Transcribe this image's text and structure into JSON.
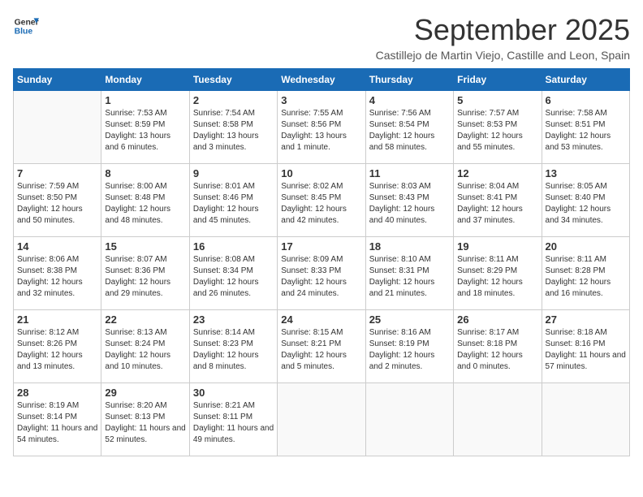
{
  "logo": {
    "line1": "General",
    "line2": "Blue"
  },
  "title": "September 2025",
  "subtitle": "Castillejo de Martin Viejo, Castille and Leon, Spain",
  "weekdays": [
    "Sunday",
    "Monday",
    "Tuesday",
    "Wednesday",
    "Thursday",
    "Friday",
    "Saturday"
  ],
  "weeks": [
    [
      {
        "day": "",
        "info": ""
      },
      {
        "day": "1",
        "info": "Sunrise: 7:53 AM\nSunset: 8:59 PM\nDaylight: 13 hours\nand 6 minutes."
      },
      {
        "day": "2",
        "info": "Sunrise: 7:54 AM\nSunset: 8:58 PM\nDaylight: 13 hours\nand 3 minutes."
      },
      {
        "day": "3",
        "info": "Sunrise: 7:55 AM\nSunset: 8:56 PM\nDaylight: 13 hours\nand 1 minute."
      },
      {
        "day": "4",
        "info": "Sunrise: 7:56 AM\nSunset: 8:54 PM\nDaylight: 12 hours\nand 58 minutes."
      },
      {
        "day": "5",
        "info": "Sunrise: 7:57 AM\nSunset: 8:53 PM\nDaylight: 12 hours\nand 55 minutes."
      },
      {
        "day": "6",
        "info": "Sunrise: 7:58 AM\nSunset: 8:51 PM\nDaylight: 12 hours\nand 53 minutes."
      }
    ],
    [
      {
        "day": "7",
        "info": "Sunrise: 7:59 AM\nSunset: 8:50 PM\nDaylight: 12 hours\nand 50 minutes."
      },
      {
        "day": "8",
        "info": "Sunrise: 8:00 AM\nSunset: 8:48 PM\nDaylight: 12 hours\nand 48 minutes."
      },
      {
        "day": "9",
        "info": "Sunrise: 8:01 AM\nSunset: 8:46 PM\nDaylight: 12 hours\nand 45 minutes."
      },
      {
        "day": "10",
        "info": "Sunrise: 8:02 AM\nSunset: 8:45 PM\nDaylight: 12 hours\nand 42 minutes."
      },
      {
        "day": "11",
        "info": "Sunrise: 8:03 AM\nSunset: 8:43 PM\nDaylight: 12 hours\nand 40 minutes."
      },
      {
        "day": "12",
        "info": "Sunrise: 8:04 AM\nSunset: 8:41 PM\nDaylight: 12 hours\nand 37 minutes."
      },
      {
        "day": "13",
        "info": "Sunrise: 8:05 AM\nSunset: 8:40 PM\nDaylight: 12 hours\nand 34 minutes."
      }
    ],
    [
      {
        "day": "14",
        "info": "Sunrise: 8:06 AM\nSunset: 8:38 PM\nDaylight: 12 hours\nand 32 minutes."
      },
      {
        "day": "15",
        "info": "Sunrise: 8:07 AM\nSunset: 8:36 PM\nDaylight: 12 hours\nand 29 minutes."
      },
      {
        "day": "16",
        "info": "Sunrise: 8:08 AM\nSunset: 8:34 PM\nDaylight: 12 hours\nand 26 minutes."
      },
      {
        "day": "17",
        "info": "Sunrise: 8:09 AM\nSunset: 8:33 PM\nDaylight: 12 hours\nand 24 minutes."
      },
      {
        "day": "18",
        "info": "Sunrise: 8:10 AM\nSunset: 8:31 PM\nDaylight: 12 hours\nand 21 minutes."
      },
      {
        "day": "19",
        "info": "Sunrise: 8:11 AM\nSunset: 8:29 PM\nDaylight: 12 hours\nand 18 minutes."
      },
      {
        "day": "20",
        "info": "Sunrise: 8:11 AM\nSunset: 8:28 PM\nDaylight: 12 hours\nand 16 minutes."
      }
    ],
    [
      {
        "day": "21",
        "info": "Sunrise: 8:12 AM\nSunset: 8:26 PM\nDaylight: 12 hours\nand 13 minutes."
      },
      {
        "day": "22",
        "info": "Sunrise: 8:13 AM\nSunset: 8:24 PM\nDaylight: 12 hours\nand 10 minutes."
      },
      {
        "day": "23",
        "info": "Sunrise: 8:14 AM\nSunset: 8:23 PM\nDaylight: 12 hours\nand 8 minutes."
      },
      {
        "day": "24",
        "info": "Sunrise: 8:15 AM\nSunset: 8:21 PM\nDaylight: 12 hours\nand 5 minutes."
      },
      {
        "day": "25",
        "info": "Sunrise: 8:16 AM\nSunset: 8:19 PM\nDaylight: 12 hours\nand 2 minutes."
      },
      {
        "day": "26",
        "info": "Sunrise: 8:17 AM\nSunset: 8:18 PM\nDaylight: 12 hours\nand 0 minutes."
      },
      {
        "day": "27",
        "info": "Sunrise: 8:18 AM\nSunset: 8:16 PM\nDaylight: 11 hours\nand 57 minutes."
      }
    ],
    [
      {
        "day": "28",
        "info": "Sunrise: 8:19 AM\nSunset: 8:14 PM\nDaylight: 11 hours\nand 54 minutes."
      },
      {
        "day": "29",
        "info": "Sunrise: 8:20 AM\nSunset: 8:13 PM\nDaylight: 11 hours\nand 52 minutes."
      },
      {
        "day": "30",
        "info": "Sunrise: 8:21 AM\nSunset: 8:11 PM\nDaylight: 11 hours\nand 49 minutes."
      },
      {
        "day": "",
        "info": ""
      },
      {
        "day": "",
        "info": ""
      },
      {
        "day": "",
        "info": ""
      },
      {
        "day": "",
        "info": ""
      }
    ]
  ]
}
